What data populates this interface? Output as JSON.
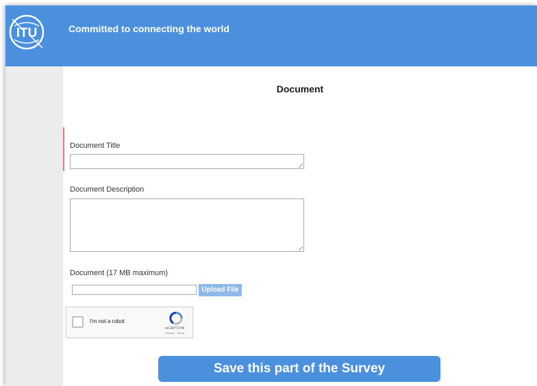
{
  "header": {
    "tagline": "Committed to connecting the world",
    "logo_text": "ITU",
    "logo_icon": "itu-globe-logo"
  },
  "page": {
    "title": "Document"
  },
  "form": {
    "title_label": "Document Title",
    "title_value": "",
    "description_label": "Document Description",
    "description_value": "",
    "file_label": "Document (17 MB maximum)",
    "file_value": "",
    "upload_label": "Upload File"
  },
  "captcha": {
    "label": "I'm not a robot",
    "brand": "reCAPTCHA",
    "terms": "Privacy - Terms",
    "icon": "recaptcha-icon"
  },
  "actions": {
    "save_label": "Save this part of the Survey"
  },
  "colors": {
    "header_bg": "#4a90dd",
    "sidebar_bg": "#ececec",
    "required_marker": "#e07a7a",
    "upload_bg": "#8fb9e8",
    "save_bg": "#4a90dd"
  }
}
